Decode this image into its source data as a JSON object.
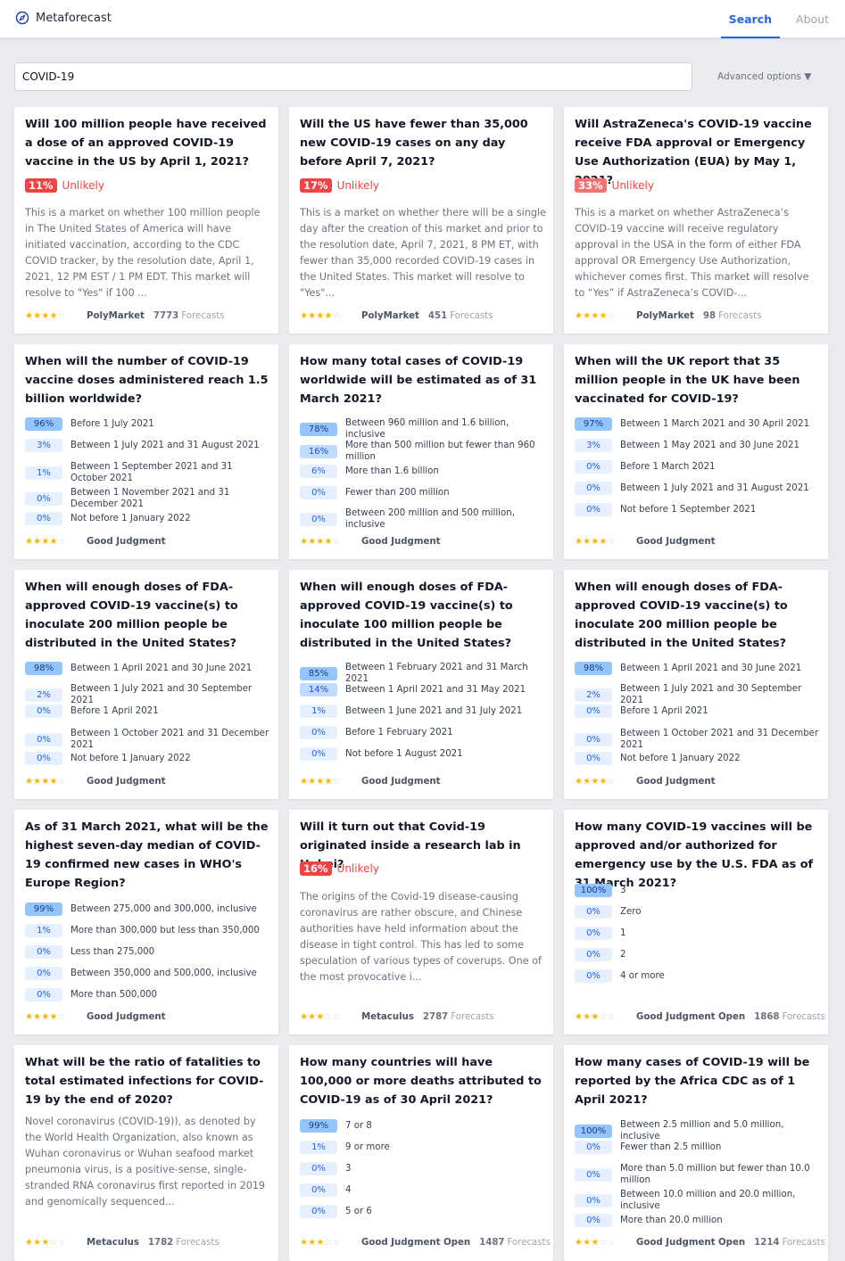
{
  "app": {
    "name": "Metaforecast",
    "logo_icon": "compass-icon"
  },
  "nav": {
    "search": "Search",
    "about": "About"
  },
  "search": {
    "value": "COVID-19",
    "advanced": "Advanced options ▼"
  },
  "cards": [
    {
      "title": "Will 100 million people have received a dose of an approved COVID-19 vaccine in the US by April 1, 2021?",
      "binary": {
        "pct": "11%",
        "word": "Unlikely"
      },
      "desc": "This is a market on whether 100 million people in The United States of America will have initiated vaccination, according to the CDC COVID tracker, by the resolution date, April 1, 2021, 12 PM EST / 1 PM EDT. This market will resolve to \"Yes\" if 100 ...",
      "stars": 4,
      "platform": "PolyMarket",
      "forecasts": "7773",
      "forecasts_label": "Forecasts"
    },
    {
      "title": "Will the US have fewer than 35,000 new COVID-19 cases on any day before April 7, 2021?",
      "binary": {
        "pct": "17%",
        "word": "Unlikely"
      },
      "desc": "This is a market on whether there will be a single day after the creation of this market and prior to the resolution date, April 7, 2021, 8 PM ET, with fewer than 35,000 recorded COVID-19 cases in the United States. This market will resolve to \"Yes\"...",
      "stars": 4,
      "platform": "PolyMarket",
      "forecasts": "451",
      "forecasts_label": "Forecasts"
    },
    {
      "title": "Will AstraZeneca's COVID-19 vaccine receive FDA approval or Emergency Use Authorization (EUA) by May 1, 2021?",
      "binary": {
        "pct": "33%",
        "word": "Unlikely"
      },
      "desc": "This is a market on whether AstraZeneca’s COVID-19 vaccine will receive regulatory approval in the USA in the form of either FDA approval OR Emergency Use Authorization, whichever comes first. This market will resolve to “Yes” if AstraZeneca’s COVID-...",
      "stars": 4,
      "platform": "PolyMarket",
      "forecasts": "98",
      "forecasts_label": "Forecasts"
    },
    {
      "title": "When will the number of COVID-19 vaccine doses administered reach 1.5 billion worldwide?",
      "options": [
        {
          "p": "96%",
          "t": "Before 1 July 2021"
        },
        {
          "p": "3%",
          "t": "Between 1 July 2021 and 31 August 2021"
        },
        {
          "p": "1%",
          "t": "Between 1 September 2021 and 31 October 2021"
        },
        {
          "p": "0%",
          "t": "Between 1 November 2021 and 31 December 2021"
        },
        {
          "p": "0%",
          "t": "Not before 1 January 2022"
        }
      ],
      "stars": 4,
      "platform": "Good Judgment"
    },
    {
      "title": "How many total cases of COVID-19 worldwide will be estimated as of 31 March 2021?",
      "options": [
        {
          "p": "78%",
          "t": "Between 960 million and 1.6 billion, inclusive"
        },
        {
          "p": "16%",
          "t": "More than 500 million but fewer than 960 million"
        },
        {
          "p": "6%",
          "t": "More than 1.6 billion"
        },
        {
          "p": "0%",
          "t": "Fewer than 200 million"
        },
        {
          "p": "0%",
          "t": "Between 200 million and 500 million, inclusive"
        }
      ],
      "stars": 4,
      "platform": "Good Judgment"
    },
    {
      "title": "When will the UK report that 35 million people in the UK have been vaccinated for COVID-19?",
      "options": [
        {
          "p": "97%",
          "t": "Between 1 March 2021 and 30 April 2021"
        },
        {
          "p": "3%",
          "t": "Between 1 May 2021 and 30 June 2021"
        },
        {
          "p": "0%",
          "t": "Before 1 March 2021"
        },
        {
          "p": "0%",
          "t": "Between 1 July 2021 and 31 August 2021"
        },
        {
          "p": "0%",
          "t": "Not before 1 September 2021"
        }
      ],
      "stars": 4,
      "platform": "Good Judgment"
    },
    {
      "title": "When will enough doses of FDA-approved COVID-19 vaccine(s) to inoculate 200 million people be distributed in the United States?",
      "options": [
        {
          "p": "98%",
          "t": "Between 1 April 2021 and 30 June 2021"
        },
        {
          "p": "2%",
          "t": "Between 1 July 2021 and 30 September 2021"
        },
        {
          "p": "0%",
          "t": "Before 1 April 2021"
        },
        {
          "p": "0%",
          "t": "Between 1 October 2021 and 31 December 2021"
        },
        {
          "p": "0%",
          "t": "Not before 1 January 2022"
        }
      ],
      "stars": 4,
      "platform": "Good Judgment"
    },
    {
      "title": "When will enough doses of FDA-approved COVID-19 vaccine(s) to inoculate 100 million people be distributed in the United States?",
      "options": [
        {
          "p": "85%",
          "t": "Between 1 February 2021 and 31 March 2021"
        },
        {
          "p": "14%",
          "t": "Between 1 April 2021 and 31 May 2021"
        },
        {
          "p": "1%",
          "t": "Between 1 June 2021 and 31 July 2021"
        },
        {
          "p": "0%",
          "t": "Before 1 February 2021"
        },
        {
          "p": "0%",
          "t": "Not before 1 August 2021"
        }
      ],
      "stars": 4,
      "platform": "Good Judgment"
    },
    {
      "title": "When will enough doses of FDA-approved COVID-19 vaccine(s) to inoculate 200 million people be distributed in the United States?",
      "options": [
        {
          "p": "98%",
          "t": "Between 1 April 2021 and 30 June 2021"
        },
        {
          "p": "2%",
          "t": "Between 1 July 2021 and 30 September 2021"
        },
        {
          "p": "0%",
          "t": "Before 1 April 2021"
        },
        {
          "p": "0%",
          "t": "Between 1 October 2021 and 31 December 2021"
        },
        {
          "p": "0%",
          "t": "Not before 1 January 2022"
        }
      ],
      "stars": 4,
      "platform": "Good Judgment"
    },
    {
      "title": "As of 31 March 2021, what will be the highest seven-day median of COVID-19 confirmed new cases in WHO's Europe Region?",
      "options": [
        {
          "p": "99%",
          "t": "Between 275,000 and 300,000, inclusive"
        },
        {
          "p": "1%",
          "t": "More than 300,000 but less than 350,000"
        },
        {
          "p": "0%",
          "t": "Less than 275,000"
        },
        {
          "p": "0%",
          "t": "Between 350,000 and 500,000, inclusive"
        },
        {
          "p": "0%",
          "t": "More than 500,000"
        }
      ],
      "stars": 4,
      "platform": "Good Judgment"
    },
    {
      "title": "Will it turn out that Covid-19 originated inside a research lab in Hubei?",
      "binary": {
        "pct": "16%",
        "word": "Unlikely"
      },
      "desc": "The origins of the Covid-19 disease-causing coronavirus are rather obscure, and Chinese authorities have held information about the disease in tight control. This has led to some speculation of various types of coverups. One of the most provocative i...",
      "stars": 3,
      "platform": "Metaculus",
      "forecasts": "2787",
      "forecasts_label": "Forecasts"
    },
    {
      "title": "How many COVID-19 vaccines will be approved and/or authorized for emergency use by the U.S. FDA as of 31 March 2021?",
      "options": [
        {
          "p": "100%",
          "t": "3"
        },
        {
          "p": "0%",
          "t": "Zero"
        },
        {
          "p": "0%",
          "t": "1"
        },
        {
          "p": "0%",
          "t": "2"
        },
        {
          "p": "0%",
          "t": "4 or more"
        }
      ],
      "stars": 3,
      "platform": "Good Judgment Open",
      "forecasts": "1868",
      "forecasts_label": "Forecasts"
    },
    {
      "title": "What will be the ratio of fatalities to total estimated infections for COVID-19 by the end of 2020?",
      "desc": "Novel coronavirus (COVID-19)), as denoted by the World Health Organization, also known as Wuhan coronavirus or Wuhan seafood market pneumonia virus, is a positive-sense, single-stranded RNA coronavirus first reported in 2019 and genomically sequenced...",
      "stars": 3,
      "platform": "Metaculus",
      "forecasts": "1782",
      "forecasts_label": "Forecasts"
    },
    {
      "title": "How many countries will have 100,000 or more deaths attributed to COVID-19 as of 30 April 2021?",
      "options": [
        {
          "p": "99%",
          "t": "7 or 8"
        },
        {
          "p": "1%",
          "t": "9 or more"
        },
        {
          "p": "0%",
          "t": "3"
        },
        {
          "p": "0%",
          "t": "4"
        },
        {
          "p": "0%",
          "t": "5 or 6"
        }
      ],
      "stars": 3,
      "platform": "Good Judgment Open",
      "forecasts": "1487",
      "forecasts_label": "Forecasts"
    },
    {
      "title": "How many cases of COVID-19 will be reported by the Africa CDC as of 1 April 2021?",
      "options": [
        {
          "p": "100%",
          "t": "Between 2.5 million and 5.0 million, inclusive"
        },
        {
          "p": "0%",
          "t": "Fewer than 2.5 million"
        },
        {
          "p": "0%",
          "t": "More than 5.0 million but fewer than 10.0 million"
        },
        {
          "p": "0%",
          "t": "Between 10.0 million and 20.0 million, inclusive"
        },
        {
          "p": "0%",
          "t": "More than 20.0 million"
        }
      ],
      "stars": 3,
      "platform": "Good Judgment Open",
      "forecasts": "1214",
      "forecasts_label": "Forecasts"
    }
  ]
}
